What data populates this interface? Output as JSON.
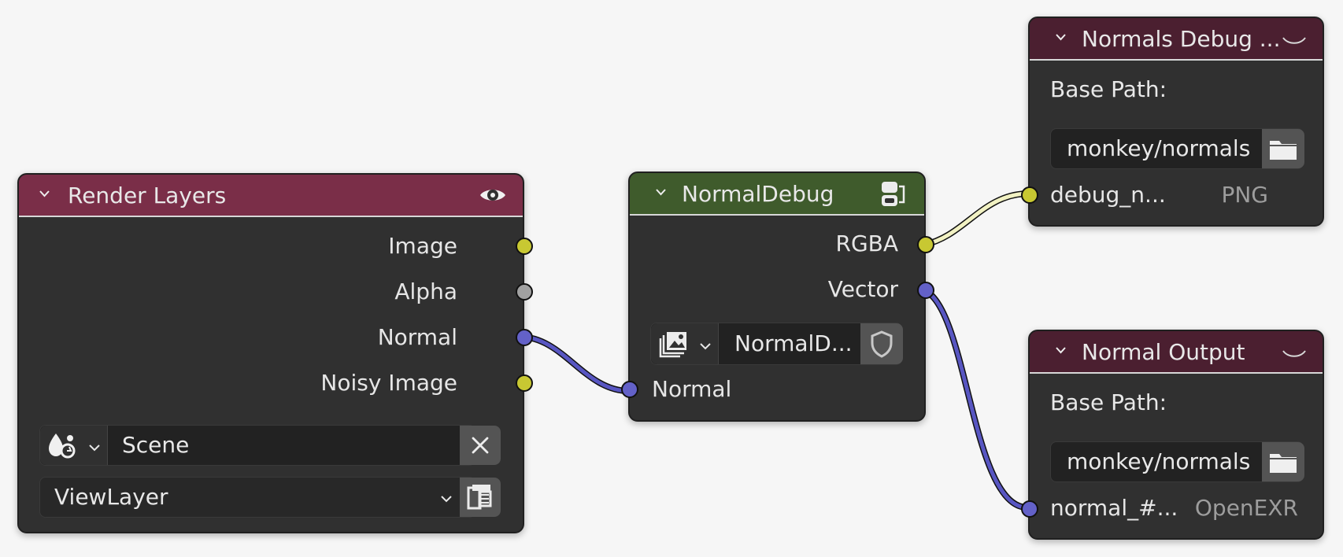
{
  "nodes": {
    "render_layers": {
      "title": "Render Layers",
      "outputs": [
        "Image",
        "Alpha",
        "Normal",
        "Noisy Image"
      ],
      "scene_value": "Scene",
      "view_layer_value": "ViewLayer",
      "header_color": "#7a2e48",
      "icons": {
        "header": "eye-icon",
        "scene": "scene-icon",
        "clear": "x-icon",
        "view_layer": "film-icon"
      }
    },
    "normal_debug": {
      "title": "NormalDebug",
      "outputs": [
        "RGBA",
        "Vector"
      ],
      "selector_value": "NormalD...",
      "input": "Normal",
      "header_color": "#3f5b2c",
      "icons": {
        "header": "node-group-icon",
        "selector": "image-icon",
        "shield": "shield-icon"
      }
    },
    "normals_debug_output": {
      "title": "Normals Debug ...",
      "base_path_label": "Base Path:",
      "base_path_value": "monkey/normals",
      "file_label": "debug_n...",
      "format": "PNG",
      "header_color": "#4b1f30",
      "icons": {
        "header": "collapse-icon",
        "browse": "folder-icon"
      }
    },
    "normal_output": {
      "title": "Normal Output",
      "base_path_label": "Base Path:",
      "base_path_value": "monkey/normals",
      "file_label": "normal_#...",
      "format": "OpenEXR",
      "header_color": "#4b1f30",
      "icons": {
        "header": "collapse-icon",
        "browse": "folder-icon"
      }
    }
  },
  "socket_colors": {
    "color": "#c8c832",
    "float": "#a1a1a1",
    "vector": "#6361c8"
  },
  "link_colors": {
    "vector": "#5856c2",
    "color": "#f2f2c3"
  }
}
